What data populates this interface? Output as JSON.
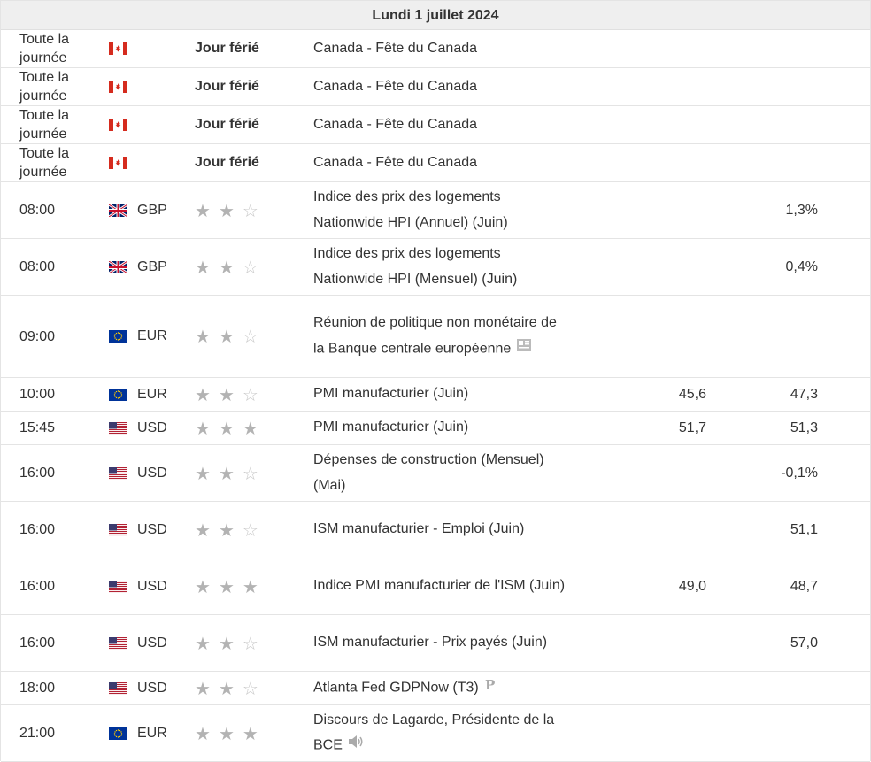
{
  "day_title": "Lundi 1 juillet 2024",
  "rows": [
    {
      "time": "Toute la journée",
      "flag": "ca",
      "currency": "",
      "holiday": "Jour férié",
      "stars": 0,
      "event": "Canada - Fête du Canada",
      "forecast": "",
      "previous": ""
    },
    {
      "time": "Toute la journée",
      "flag": "ca",
      "currency": "",
      "holiday": "Jour férié",
      "stars": 0,
      "event": "Canada - Fête du Canada",
      "forecast": "",
      "previous": ""
    },
    {
      "time": "Toute la journée",
      "flag": "ca",
      "currency": "",
      "holiday": "Jour férié",
      "stars": 0,
      "event": "Canada - Fête du Canada",
      "forecast": "",
      "previous": ""
    },
    {
      "time": "Toute la journée",
      "flag": "ca",
      "currency": "",
      "holiday": "Jour férié",
      "stars": 0,
      "event": "Canada - Fête du Canada",
      "forecast": "",
      "previous": ""
    },
    {
      "time": "08:00",
      "flag": "gb",
      "currency": "GBP",
      "holiday": "",
      "stars": 2,
      "event": "Indice des prix des logements Nationwide HPI (Annuel) (Juin)",
      "forecast": "",
      "previous": "1,3%"
    },
    {
      "time": "08:00",
      "flag": "gb",
      "currency": "GBP",
      "holiday": "",
      "stars": 2,
      "event": "Indice des prix des logements Nationwide HPI (Mensuel) (Juin)",
      "forecast": "",
      "previous": "0,4%"
    },
    {
      "time": "09:00",
      "flag": "eu",
      "currency": "EUR",
      "holiday": "",
      "stars": 2,
      "event": "Réunion de politique non monétaire de la Banque centrale européenne",
      "icon": "report-icon",
      "forecast": "",
      "previous": ""
    },
    {
      "time": "10:00",
      "flag": "eu",
      "currency": "EUR",
      "holiday": "",
      "stars": 2,
      "event": "PMI manufacturier (Juin)",
      "forecast": "45,6",
      "previous": "47,3"
    },
    {
      "time": "15:45",
      "flag": "us",
      "currency": "USD",
      "holiday": "",
      "stars": 3,
      "event": "PMI manufacturier (Juin)",
      "forecast": "51,7",
      "previous": "51,3"
    },
    {
      "time": "16:00",
      "flag": "us",
      "currency": "USD",
      "holiday": "",
      "stars": 2,
      "event": "Dépenses de construction (Mensuel) (Mai)",
      "forecast": "",
      "previous": "-0,1%"
    },
    {
      "time": "16:00",
      "flag": "us",
      "currency": "USD",
      "holiday": "",
      "stars": 2,
      "event": "ISM manufacturier - Emploi (Juin)",
      "forecast": "",
      "previous": "51,1"
    },
    {
      "time": "16:00",
      "flag": "us",
      "currency": "USD",
      "holiday": "",
      "stars": 3,
      "event": "Indice PMI manufacturier de l'ISM (Juin)",
      "forecast": "49,0",
      "previous": "48,7"
    },
    {
      "time": "16:00",
      "flag": "us",
      "currency": "USD",
      "holiday": "",
      "stars": 2,
      "event": "ISM manufacturier - Prix payés (Juin)",
      "forecast": "",
      "previous": "57,0"
    },
    {
      "time": "18:00",
      "flag": "us",
      "currency": "USD",
      "holiday": "",
      "stars": 2,
      "event": "Atlanta Fed GDPNow (T3)",
      "icon": "preliminary-icon",
      "forecast": "",
      "previous": ""
    },
    {
      "time": "21:00",
      "flag": "eu",
      "currency": "EUR",
      "holiday": "",
      "stars": 3,
      "event": "Discours de Lagarde, Présidente de la BCE",
      "icon": "speaker-icon",
      "forecast": "",
      "previous": ""
    }
  ],
  "colors": {
    "header_bg": "#efefef",
    "border": "#e4e4e4",
    "star_full": "#b3b3b3",
    "star_empty": "#c8c8c8",
    "text": "#333333"
  }
}
